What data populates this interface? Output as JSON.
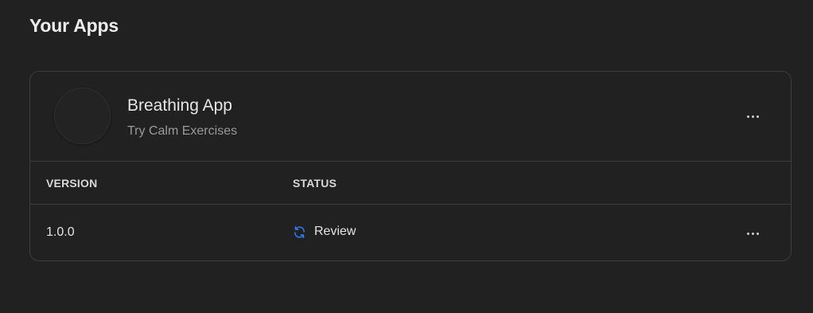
{
  "page": {
    "title": "Your Apps"
  },
  "app": {
    "name": "Breathing App",
    "subtitle": "Try Calm Exercises",
    "menu_icon": "more-horizontal-icon"
  },
  "table": {
    "columns": [
      "VERSION",
      "STATUS"
    ],
    "rows": [
      {
        "version": "1.0.0",
        "status": "Review",
        "status_icon": "refresh-icon",
        "status_icon_color": "#2f7df6",
        "menu_icon": "more-horizontal-icon"
      }
    ]
  },
  "colors": {
    "background": "#212121",
    "border": "#3d3d3d",
    "accent": "#2f7df6"
  }
}
